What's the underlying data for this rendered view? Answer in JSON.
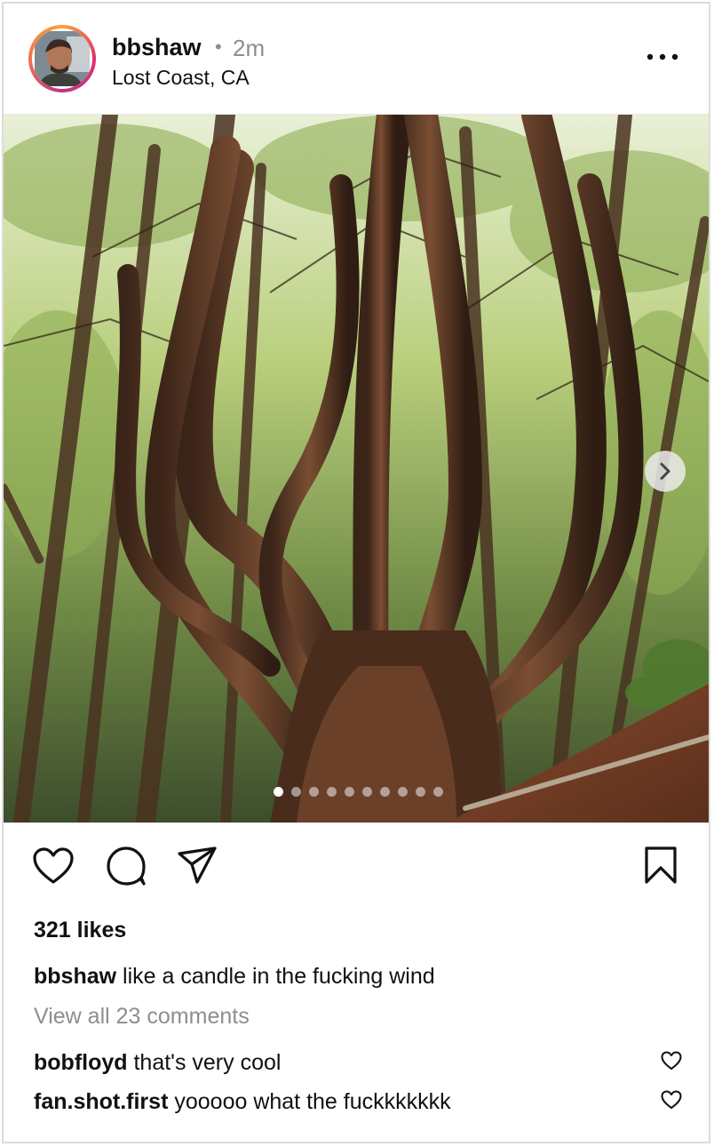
{
  "post": {
    "username": "bbshaw",
    "separator": "•",
    "time": "2m",
    "location": "Lost Coast, CA",
    "likes": "321 likes",
    "caption_user": "bbshaw",
    "caption_text": "like a candle in the fucking wind",
    "view_comments": "View all 23 comments",
    "comments": [
      {
        "user": "bobfloyd",
        "text": "that's very cool"
      },
      {
        "user": "fan.shot.first",
        "text": "yooooo what the fuckkkkkkk"
      }
    ],
    "carousel_total": 10,
    "carousel_active": 1
  },
  "icons": {
    "more": "more-icon",
    "like": "heart-icon",
    "comment": "comment-icon",
    "share": "send-icon",
    "save": "bookmark-icon",
    "next": "chevron-right-icon"
  }
}
